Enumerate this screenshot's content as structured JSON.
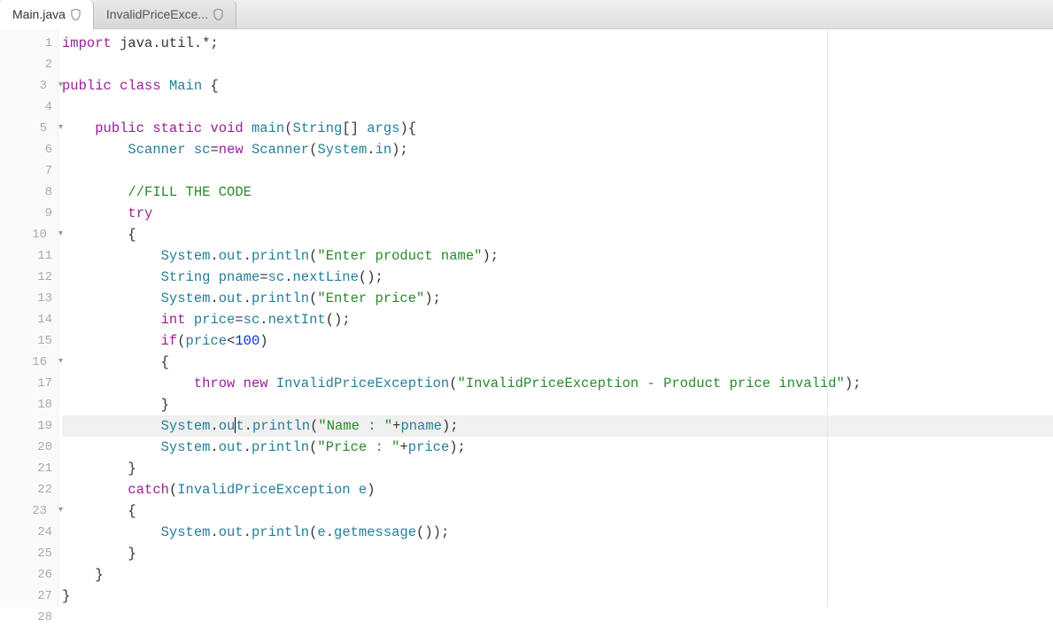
{
  "tabs": [
    {
      "label": "Main.java",
      "active": true
    },
    {
      "label": "InvalidPriceExce...",
      "active": false
    }
  ],
  "gutter": {
    "lines": [
      {
        "num": "1",
        "fold": false
      },
      {
        "num": "2",
        "fold": false
      },
      {
        "num": "3",
        "fold": true
      },
      {
        "num": "4",
        "fold": false
      },
      {
        "num": "5",
        "fold": true
      },
      {
        "num": "6",
        "fold": false
      },
      {
        "num": "7",
        "fold": false
      },
      {
        "num": "8",
        "fold": false
      },
      {
        "num": "9",
        "fold": false
      },
      {
        "num": "10",
        "fold": true
      },
      {
        "num": "11",
        "fold": false
      },
      {
        "num": "12",
        "fold": false
      },
      {
        "num": "13",
        "fold": false
      },
      {
        "num": "14",
        "fold": false
      },
      {
        "num": "15",
        "fold": false
      },
      {
        "num": "16",
        "fold": true
      },
      {
        "num": "17",
        "fold": false
      },
      {
        "num": "18",
        "fold": false
      },
      {
        "num": "19",
        "fold": false
      },
      {
        "num": "20",
        "fold": false
      },
      {
        "num": "21",
        "fold": false
      },
      {
        "num": "22",
        "fold": false
      },
      {
        "num": "23",
        "fold": true
      },
      {
        "num": "24",
        "fold": false
      },
      {
        "num": "25",
        "fold": false
      },
      {
        "num": "26",
        "fold": false
      },
      {
        "num": "27",
        "fold": false
      },
      {
        "num": "28",
        "fold": false
      }
    ]
  },
  "code": {
    "highlighted_line": 19,
    "tokens": {
      "import": "import",
      "java_util": " java.util.*;",
      "public": "public",
      "class": "class",
      "Main": "Main",
      "static": "static",
      "void": "void",
      "main": "main",
      "String": "String",
      "args": "args",
      "Scanner": "Scanner",
      "sc": "sc",
      "new": "new",
      "System": "System",
      "in": "in",
      "fill_comment": "//FILL THE CODE",
      "try": "try",
      "out": "out",
      "println": "println",
      "str_enter_product": "\"Enter product name\"",
      "pname": "pname",
      "nextLine": "nextLine",
      "str_enter_price": "\"Enter price\"",
      "int": "int",
      "price": "price",
      "nextInt": "nextInt",
      "if": "if",
      "num_100": "100",
      "throw": "throw",
      "InvalidPriceException": "InvalidPriceException",
      "str_invalid": "\"InvalidPriceException - Product price invalid\"",
      "str_name": "\"Name : \"",
      "str_price": "\"Price : \"",
      "catch": "catch",
      "e": "e",
      "getmessage": "getmessage"
    }
  }
}
